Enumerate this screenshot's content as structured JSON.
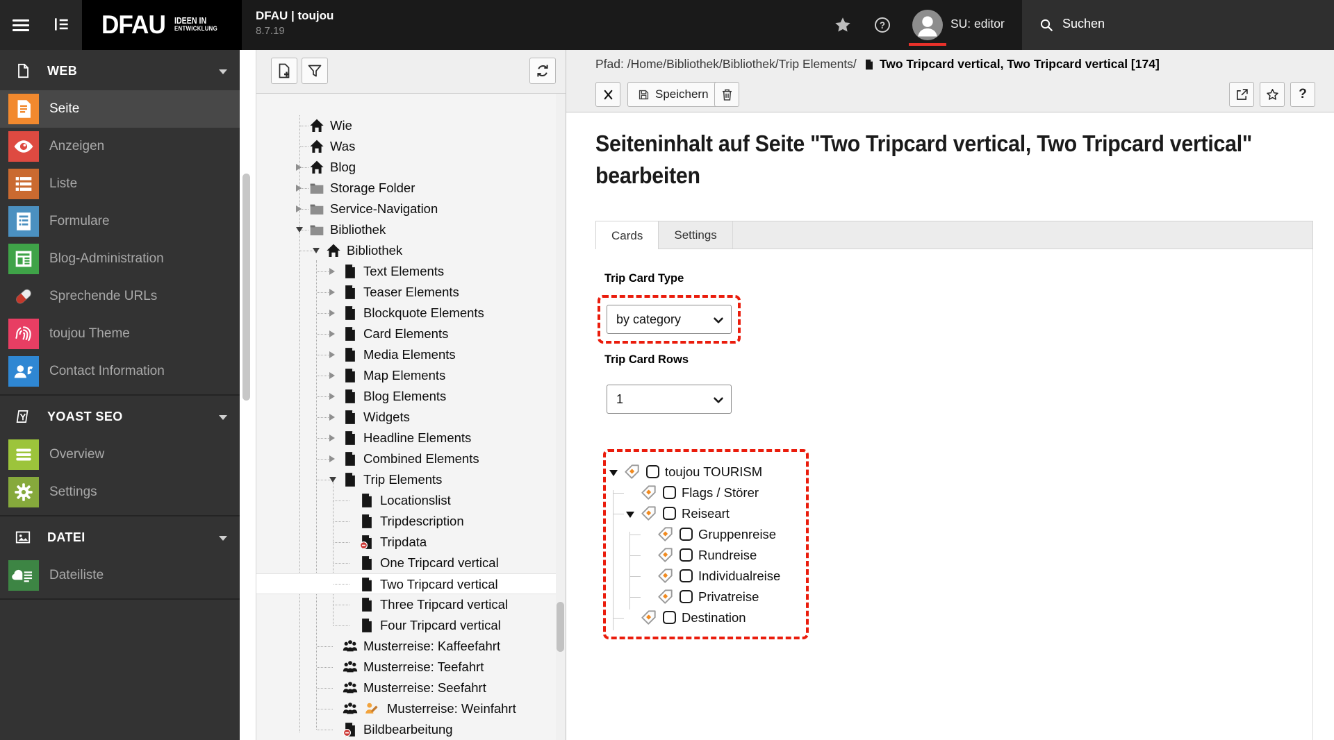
{
  "topbar": {
    "logo_main": "DFAU",
    "logo_sub_line1": "IDEEN IN",
    "logo_sub_line2": "ENTWICKLUNG",
    "site_title": "DFAU | toujou",
    "version": "8.7.19",
    "user_label": "SU: editor",
    "search_label": "Suchen"
  },
  "sidebar": {
    "groups": [
      {
        "label": "WEB",
        "icon": "web",
        "items": [
          {
            "label": "Seite",
            "icon": "page-lines",
            "color": "#f2892e",
            "active": true
          },
          {
            "label": "Anzeigen",
            "icon": "eye",
            "color": "#de4a41",
            "active": false
          },
          {
            "label": "Liste",
            "icon": "list",
            "color": "#ca6a30",
            "active": false
          },
          {
            "label": "Formulare",
            "icon": "form",
            "color": "#4b90c0",
            "active": false
          },
          {
            "label": "Blog-Administration",
            "icon": "news",
            "color": "#3fa348",
            "active": false
          },
          {
            "label": "Sprechende URLs",
            "icon": "pill",
            "color": "",
            "active": false
          },
          {
            "label": "toujou Theme",
            "icon": "fingerprint",
            "color": "#e83e63",
            "active": false
          },
          {
            "label": "Contact Information",
            "icon": "contact",
            "color": "#2f87d3",
            "active": false
          }
        ]
      },
      {
        "label": "YOAST SEO",
        "icon": "yoast",
        "items": [
          {
            "label": "Overview",
            "icon": "bars",
            "color": "#9cc43b",
            "active": false
          },
          {
            "label": "Settings",
            "icon": "gear",
            "color": "#86a93c",
            "active": false
          }
        ]
      },
      {
        "label": "DATEI",
        "icon": "image",
        "items": [
          {
            "label": "Dateiliste",
            "icon": "filelist",
            "color": "#3d8544",
            "active": false
          }
        ]
      }
    ]
  },
  "pagetree": {
    "items": [
      {
        "label": "Wie",
        "level": 0,
        "icon": "home",
        "caret": null,
        "selected": false
      },
      {
        "label": "Was",
        "level": 0,
        "icon": "home",
        "caret": null,
        "selected": false
      },
      {
        "label": "Blog",
        "level": 0,
        "icon": "home",
        "caret": "right",
        "selected": false
      },
      {
        "label": "Storage Folder",
        "level": 0,
        "icon": "folder",
        "caret": "right",
        "selected": false
      },
      {
        "label": "Service-Navigation",
        "level": 0,
        "icon": "folder",
        "caret": "right",
        "selected": false
      },
      {
        "label": "Bibliothek",
        "level": 0,
        "icon": "folder",
        "caret": "down",
        "selected": false
      },
      {
        "label": "Bibliothek",
        "level": 1,
        "icon": "home",
        "caret": "down",
        "selected": false
      },
      {
        "label": "Text Elements",
        "level": 2,
        "icon": "page",
        "caret": "right",
        "selected": false
      },
      {
        "label": "Teaser Elements",
        "level": 2,
        "icon": "page",
        "caret": "right",
        "selected": false
      },
      {
        "label": "Blockquote Elements",
        "level": 2,
        "icon": "page",
        "caret": "right",
        "selected": false
      },
      {
        "label": "Card Elements",
        "level": 2,
        "icon": "page",
        "caret": "right",
        "selected": false
      },
      {
        "label": "Media Elements",
        "level": 2,
        "icon": "page",
        "caret": "right",
        "selected": false
      },
      {
        "label": "Map Elements",
        "level": 2,
        "icon": "page",
        "caret": "right",
        "selected": false
      },
      {
        "label": "Blog Elements",
        "level": 2,
        "icon": "page",
        "caret": "right",
        "selected": false
      },
      {
        "label": "Widgets",
        "level": 2,
        "icon": "page",
        "caret": "right",
        "selected": false
      },
      {
        "label": "Headline Elements",
        "level": 2,
        "icon": "page",
        "caret": "right",
        "selected": false
      },
      {
        "label": "Combined Elements",
        "level": 2,
        "icon": "page",
        "caret": "right",
        "selected": false
      },
      {
        "label": "Trip Elements",
        "level": 2,
        "icon": "page",
        "caret": "down",
        "selected": false
      },
      {
        "label": "Locationslist",
        "level": 3,
        "icon": "page",
        "caret": null,
        "selected": false
      },
      {
        "label": "Tripdescription",
        "level": 3,
        "icon": "page",
        "caret": null,
        "selected": false
      },
      {
        "label": "Tripdata",
        "level": 3,
        "icon": "page-hidden",
        "caret": null,
        "selected": false
      },
      {
        "label": "One Tripcard vertical",
        "level": 3,
        "icon": "page",
        "caret": null,
        "selected": false
      },
      {
        "label": "Two Tripcard vertical",
        "level": 3,
        "icon": "page",
        "caret": null,
        "selected": true
      },
      {
        "label": "Three Tripcard vertical",
        "level": 3,
        "icon": "page",
        "caret": null,
        "selected": false
      },
      {
        "label": "Four Tripcard vertical",
        "level": 3,
        "icon": "page",
        "caret": null,
        "selected": false
      },
      {
        "label": "Musterreise: Kaffeefahrt",
        "level": 2,
        "icon": "people",
        "caret": null,
        "selected": false
      },
      {
        "label": "Musterreise: Teefahrt",
        "level": 2,
        "icon": "people",
        "caret": null,
        "selected": false
      },
      {
        "label": "Musterreise: Seefahrt",
        "level": 2,
        "icon": "people",
        "caret": null,
        "selected": false
      },
      {
        "label": "Musterreise: Weinfahrt",
        "level": 2,
        "icon": "people",
        "caret": null,
        "selected": false,
        "extra_icon": "writer"
      },
      {
        "label": "Bildbearbeitung",
        "level": 2,
        "icon": "page-hidden",
        "caret": null,
        "selected": false
      }
    ]
  },
  "docheader": {
    "path_label": "Pfad:",
    "path": "/Home/Bibliothek/Bibliothek/Trip Elements/",
    "document_title": "Two Tripcard vertical, Two Tripcard vertical [174]",
    "save_label": "Speichern"
  },
  "main": {
    "heading": "Seiteninhalt auf Seite \"Two Tripcard vertical, Two Tripcard vertical\" bearbeiten",
    "tabs": [
      {
        "label": "Cards",
        "active": true
      },
      {
        "label": "Settings",
        "active": false
      }
    ],
    "fields": {
      "trip_card_type": {
        "label": "Trip Card Type",
        "value": "by category",
        "highlighted": true
      },
      "trip_card_rows": {
        "label": "Trip Card Rows",
        "value": "1",
        "highlighted": false
      }
    },
    "category_tree": {
      "highlighted": true,
      "items": [
        {
          "label": "toujou TOURISM",
          "level": 0,
          "caret": "down",
          "checked": false
        },
        {
          "label": "Flags / Störer",
          "level": 1,
          "caret": null,
          "checked": false
        },
        {
          "label": "Reiseart",
          "level": 1,
          "caret": "down",
          "checked": false
        },
        {
          "label": "Gruppenreise",
          "level": 2,
          "caret": null,
          "checked": false
        },
        {
          "label": "Rundreise",
          "level": 2,
          "caret": null,
          "checked": false
        },
        {
          "label": "Individualreise",
          "level": 2,
          "caret": null,
          "checked": false
        },
        {
          "label": "Privatreise",
          "level": 2,
          "caret": null,
          "checked": false
        },
        {
          "label": "Destination",
          "level": 1,
          "caret": null,
          "checked": false
        }
      ]
    }
  }
}
